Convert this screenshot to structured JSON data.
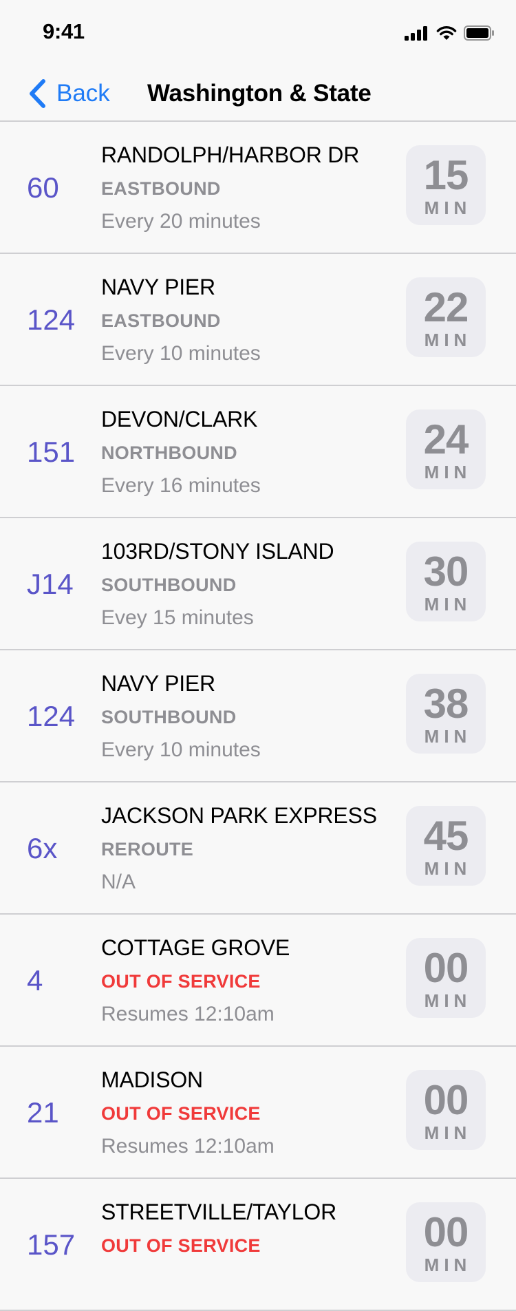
{
  "status_bar": {
    "time": "9:41"
  },
  "nav": {
    "back_label": "Back",
    "title": "Washington & State"
  },
  "routes": [
    {
      "number": "60",
      "destination": "RANDOLPH/HARBOR DR",
      "direction": "EASTBOUND",
      "frequency": "Every 20 minutes",
      "minutes": "15",
      "unit": "MIN",
      "alert": false
    },
    {
      "number": "124",
      "destination": "NAVY PIER",
      "direction": "EASTBOUND",
      "frequency": "Every 10 minutes",
      "minutes": "22",
      "unit": "MIN",
      "alert": false
    },
    {
      "number": "151",
      "destination": "DEVON/CLARK",
      "direction": "NORTHBOUND",
      "frequency": "Every 16 minutes",
      "minutes": "24",
      "unit": "MIN",
      "alert": false
    },
    {
      "number": "J14",
      "destination": "103RD/STONY ISLAND",
      "direction": "SOUTHBOUND",
      "frequency": "Evey 15 minutes",
      "minutes": "30",
      "unit": "MIN",
      "alert": false
    },
    {
      "number": "124",
      "destination": "NAVY PIER",
      "direction": "SOUTHBOUND",
      "frequency": "Every 10 minutes",
      "minutes": "38",
      "unit": "MIN",
      "alert": false
    },
    {
      "number": "6x",
      "destination": "JACKSON PARK EXPRESS",
      "direction": "REROUTE",
      "frequency": "N/A",
      "minutes": "45",
      "unit": "MIN",
      "alert": false
    },
    {
      "number": "4",
      "destination": "COTTAGE GROVE",
      "direction": "OUT OF SERVICE",
      "frequency": "Resumes 12:10am",
      "minutes": "00",
      "unit": "MIN",
      "alert": true
    },
    {
      "number": "21",
      "destination": "MADISON",
      "direction": "OUT OF SERVICE",
      "frequency": "Resumes 12:10am",
      "minutes": "00",
      "unit": "MIN",
      "alert": true
    },
    {
      "number": "157",
      "destination": "STREETVILLE/TAYLOR",
      "direction": "OUT OF SERVICE",
      "frequency": "",
      "minutes": "00",
      "unit": "MIN",
      "alert": true
    }
  ],
  "colors": {
    "accent": "#1f7bf6",
    "route": "#5a55c8",
    "alert": "#f03a3a",
    "muted": "#8e8e93"
  }
}
